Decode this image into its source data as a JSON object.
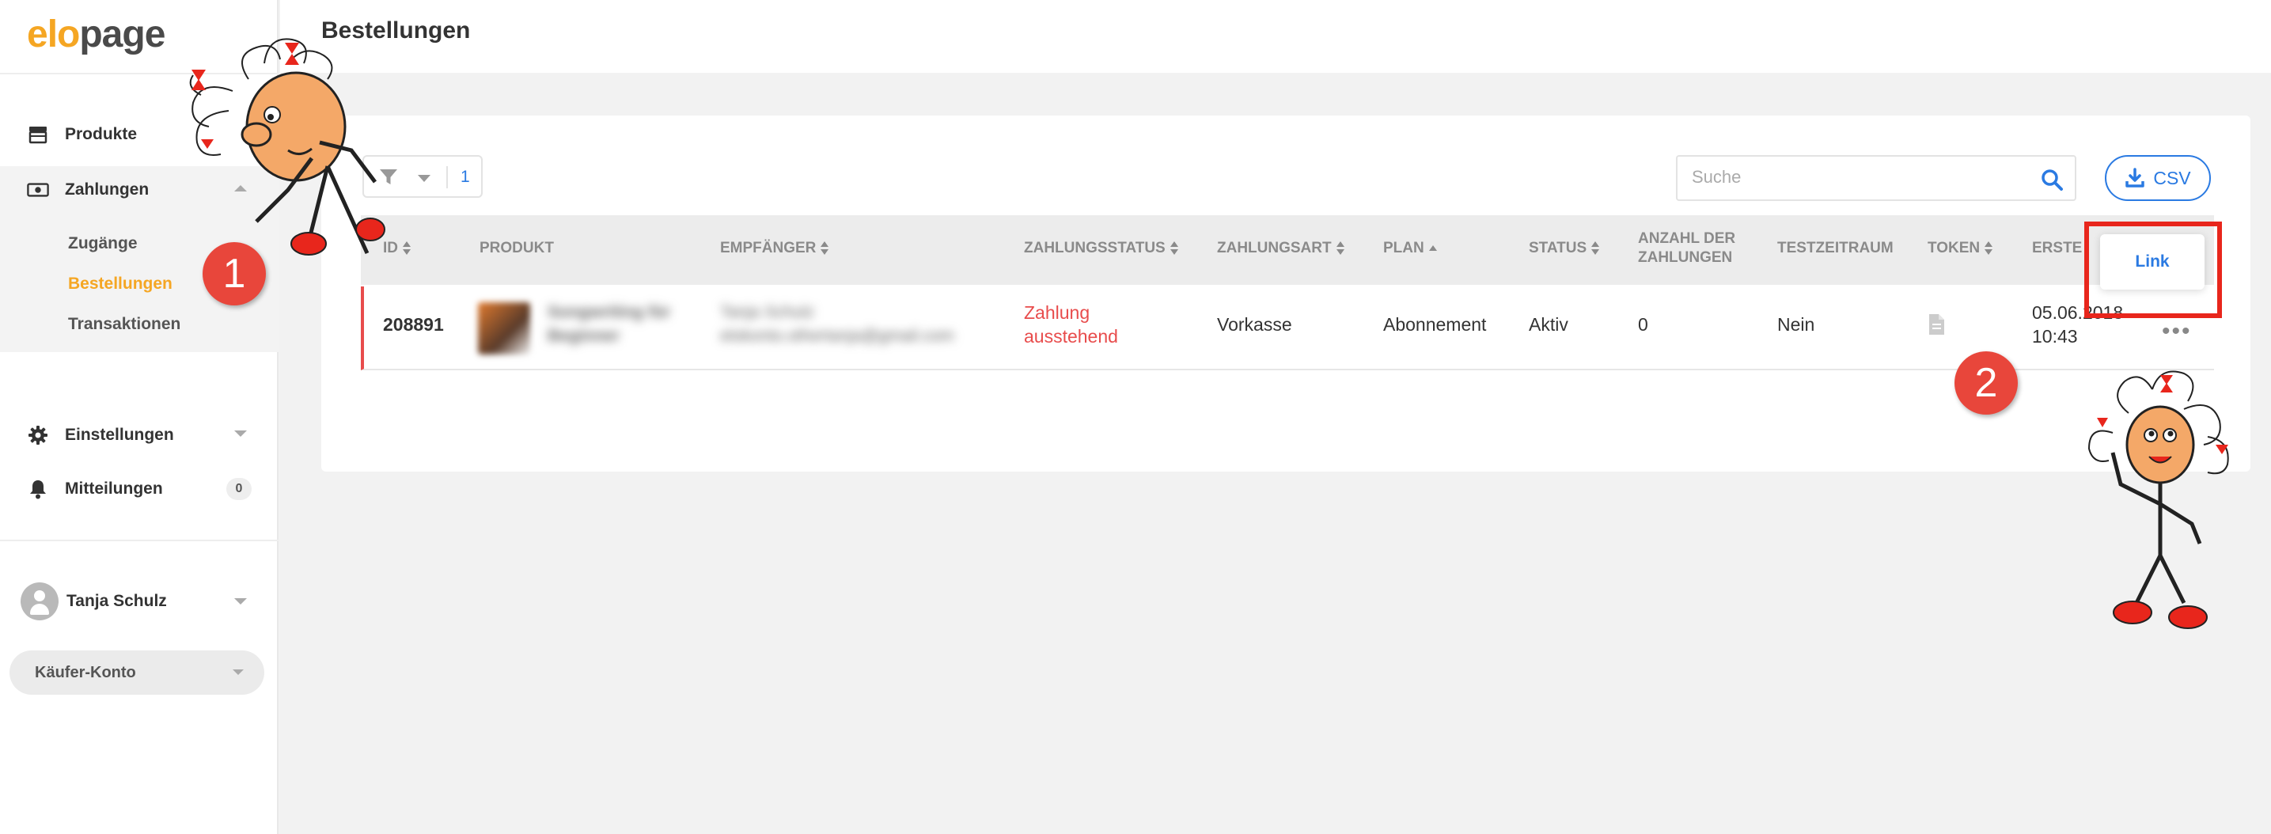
{
  "logo": {
    "part1": "elo",
    "part2": "page"
  },
  "sidebar": {
    "items": [
      {
        "label": "Produkte",
        "icon": "store-icon"
      },
      {
        "label": "Zahlungen",
        "icon": "money-icon"
      },
      {
        "label": "Einstellungen",
        "icon": "gear-icon"
      },
      {
        "label": "Mitteilungen",
        "icon": "bell-icon",
        "badge": "0"
      }
    ],
    "sub_items": [
      {
        "label": "Zugänge",
        "active": false
      },
      {
        "label": "Bestellungen",
        "active": true
      },
      {
        "label": "Transaktionen",
        "active": false
      }
    ],
    "user": {
      "name": "Tanja Schulz"
    },
    "buyer_account": "Käufer-Konto"
  },
  "header": {
    "title": "Bestellungen"
  },
  "toolbar": {
    "filter_count": "1",
    "search_placeholder": "Suche",
    "csv_label": "CSV"
  },
  "table": {
    "columns": [
      "ID",
      "PRODUKT",
      "EMPFÄNGER",
      "ZAHLUNGSSTATUS",
      "ZAHLUNGSART",
      "PLAN",
      "STATUS",
      "ANZAHL DER",
      "ZAHLUNGEN",
      "TESTZEITRAUM",
      "TOKEN",
      "ERSTE"
    ],
    "rows": [
      {
        "id": "208891",
        "product_line1": "Songwriting für",
        "product_line2": "Beginner",
        "recipient_name": "Tanja Schulz",
        "recipient_email": "elokonto.othertanja@gmail.com",
        "payment_status_line1": "Zahlung",
        "payment_status_line2": "ausstehend",
        "payment_method": "Vorkasse",
        "plan": "Abonnement",
        "status": "Aktiv",
        "payment_count": "0",
        "trial": "Nein",
        "created_date": "05.06.2018",
        "created_time": "10:43"
      }
    ]
  },
  "popup": {
    "link_label": "Link"
  },
  "steps": [
    "1",
    "2"
  ],
  "colors": {
    "accent": "#f5a623",
    "link": "#2a7ae2",
    "alert": "#e84c4c",
    "highlight": "#e8261c"
  }
}
